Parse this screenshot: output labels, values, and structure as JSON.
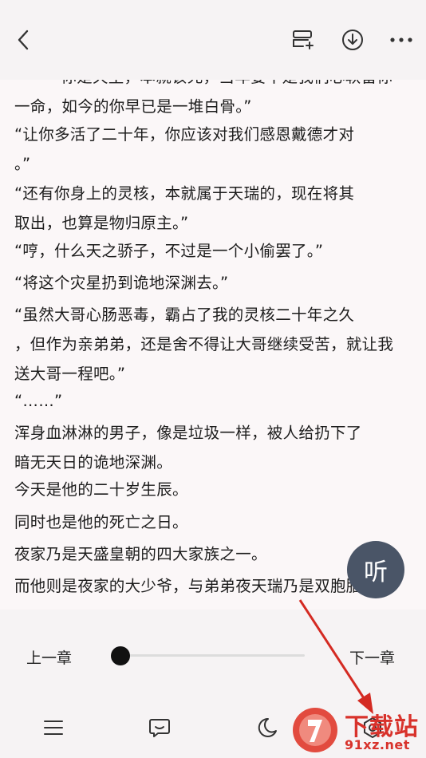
{
  "listen_label": "听",
  "paragraphs": [
    {
      "lines": [
        "“你是天生，本就该死，当年要不是我们心软留你",
        "一命，如今的你早已是一堆白骨。”"
      ]
    },
    {
      "lines": [
        "    “让你多活了二十年，你应该对我们感恩戴德才对",
        "。”"
      ]
    },
    {
      "lines": [
        "    “还有你身上的灵核，本就属于天瑞的，现在将其",
        "取出，也算是物归原主。”"
      ]
    },
    {
      "lines": [
        "    “哼，什么天之骄子，不过是一个小偷罢了。”"
      ]
    },
    {
      "lines": [
        "    “将这个灾星扔到诡地深渊去。”"
      ]
    },
    {
      "lines": [
        "    “虽然大哥心肠恶毒，霸占了我的灵核二十年之久",
        "，但作为亲弟弟，还是舍不得让大哥继续受苦，就让我",
        "送大哥一程吧。”"
      ]
    },
    {
      "lines": [
        "    “……”"
      ]
    },
    {
      "lines": [
        "    浑身血淋淋的男子，像是垃圾一样，被人给扔下了",
        "暗无天日的诡地深渊。"
      ]
    },
    {
      "lines": [
        "    今天是他的二十岁生辰。"
      ]
    },
    {
      "lines": [
        "    同时也是他的死亡之日。"
      ]
    },
    {
      "lines": [
        "    夜家乃是天盛皇朝的四大家族之一。"
      ]
    },
    {
      "lines": [
        "    而他则是夜家的大少爷，与弟弟夜天瑞乃是双胞胎"
      ]
    }
  ],
  "reader": {
    "prev_chapter": "上一章",
    "next_chapter": "下一章",
    "progress": 0.0
  },
  "toolbar": {
    "icons": [
      "menu-icon",
      "comment-icon",
      "night-mode-icon",
      "settings-icon"
    ]
  },
  "watermark": {
    "cn": "下载站",
    "url": "91xz.net"
  },
  "colors": {
    "accent": "#d8322b",
    "listen_bg": "#4a5567",
    "bar_bg": "#f6f3f4",
    "page_bg": "#fbf7f8"
  }
}
